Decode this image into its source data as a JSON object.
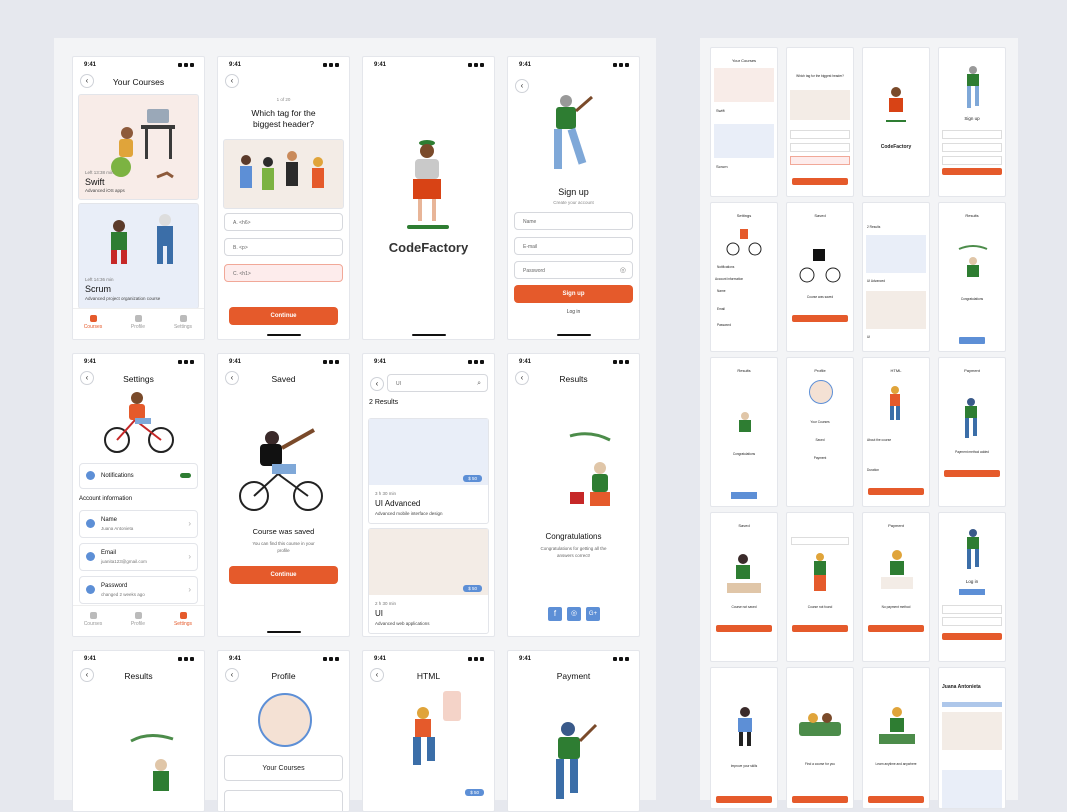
{
  "status_time": "9:41",
  "colors": {
    "accent": "#e55a2b",
    "blue": "#5d8fd6"
  },
  "courses": {
    "title": "Your Courses",
    "swift_meta": "Left 13:38 min",
    "swift_name": "Swift",
    "swift_desc": "Advanced iOS apps",
    "scrum_meta": "Left 14:36 min",
    "scrum_name": "Scrum",
    "scrum_desc": "Advanced project organization course",
    "tabs": [
      "Courses",
      "Profile",
      "Settings"
    ]
  },
  "quiz": {
    "progress": "1 of 20",
    "question": "Which tag for the biggest header?",
    "options": [
      "A.  <h6>",
      "B.  <p>",
      "C.  <h1>"
    ],
    "continue": "Continue"
  },
  "splash": {
    "brand": "CodeFactory"
  },
  "signup": {
    "title": "Sign up",
    "subtitle": "Create your account",
    "name_ph": "Name",
    "email_ph": "E-mail",
    "password_ph": "Password",
    "signup_btn": "Sign up",
    "login_link": "Log in"
  },
  "settings": {
    "title": "Settings",
    "notifications": "Notifications",
    "section": "Account information",
    "name_label": "Name",
    "name_value": "Juana Antonieta",
    "email_label": "Email",
    "email_value": "juanita123@gmail.com",
    "password_label": "Password",
    "password_value": "changed 2 weeks ago",
    "tabs": [
      "Courses",
      "Profile",
      "Settings"
    ]
  },
  "saved": {
    "title": "Saved",
    "heading": "Course was saved",
    "body": "You can find this course in your profile",
    "continue": "Continue"
  },
  "search": {
    "query": "UI",
    "results": "2 Results",
    "r1_meta": "3 h 30 min",
    "r1_name": "UI Advanced",
    "r1_desc": "Advanced mobile interface design",
    "r1_badge": "$ 50",
    "r2_meta": "2 h 30 min",
    "r2_name": "UI",
    "r2_desc": "Advanced web applications",
    "r2_badge": "$ 50"
  },
  "results": {
    "title": "Results",
    "heading": "Congratulations",
    "body": "Congratulations for getting all the answers correct!",
    "socials": [
      "f",
      "◎",
      "G+"
    ]
  },
  "row3": {
    "results_title": "Results",
    "profile_title": "Profile",
    "profile_item": "Your Courses",
    "html_title": "HTML",
    "html_badge": "$ 50",
    "payment_title": "Payment"
  },
  "thumbs": {
    "your_courses": "Your Courses",
    "which_tag": "Which tag for the biggest header?",
    "codefactory": "CodeFactory",
    "signup": "Sign up",
    "settings": "Settings",
    "saved": "Saved",
    "two_results": "2 Results",
    "results": "Results",
    "congratulations": "Congratulations",
    "course_was_saved": "Course was saved",
    "ui_advanced": "UI Advanced",
    "profile": "Profile",
    "html": "HTML",
    "about_course": "About the course",
    "payment": "Payment",
    "payment_added": "Payment method added",
    "course_not_saved": "Course not saved",
    "course_not_found": "Course not found",
    "no_payment": "No payment method",
    "log_in": "Log in",
    "improve": "Improve your skills",
    "find": "Find a course for you",
    "learn": "Learn anytime and anywhere",
    "juana": "Juana Antonieta",
    "swift": "Swift",
    "scrum": "Scrum",
    "continue": "Continue",
    "notifications": "Notifications",
    "account_info": "Account information",
    "name": "Name",
    "email": "Email",
    "password": "Password",
    "ui": "UI",
    "your_courses_btn": "Your Courses",
    "saved_btn": "Saved",
    "payment_btn": "Payment",
    "duration": "Duration"
  }
}
